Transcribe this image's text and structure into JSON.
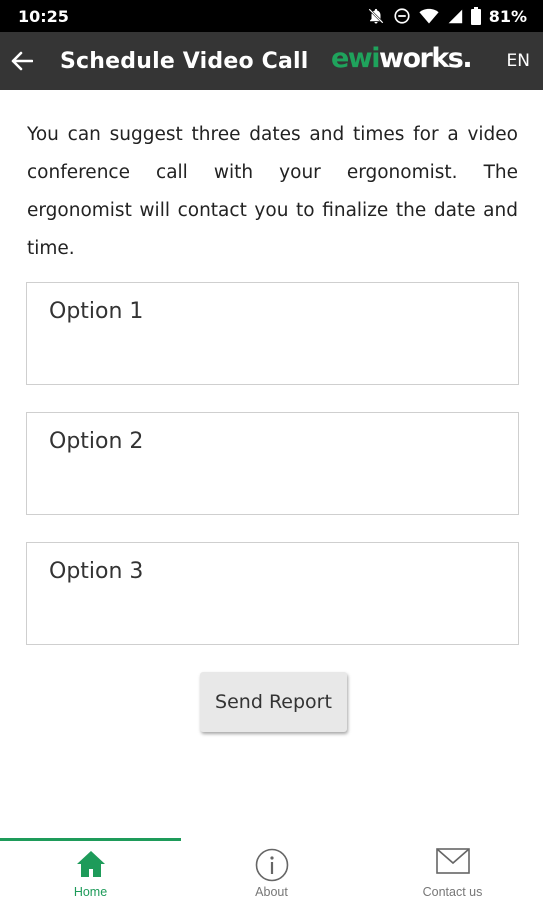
{
  "status_bar": {
    "time": "10:25",
    "battery": "81%"
  },
  "app_bar": {
    "title": "Schedule Video Call",
    "brand_ewi": "ewi",
    "brand_works": "works.",
    "language": "EN"
  },
  "intro_text": "You can suggest three dates and times for a video conference call with your ergonomist. The ergonomist will contact you to finalize the date and time.",
  "options": [
    {
      "placeholder": "Option 1"
    },
    {
      "placeholder": "Option 2"
    },
    {
      "placeholder": "Option 3"
    }
  ],
  "send_label": "Send Report",
  "bottom_nav": [
    {
      "label": "Home",
      "icon": "home-icon",
      "active": true
    },
    {
      "label": "About",
      "icon": "info-icon",
      "active": false
    },
    {
      "label": "Contact us",
      "icon": "mail-icon",
      "active": false
    }
  ],
  "colors": {
    "accent": "#1e9b5a",
    "app_bar": "#353535",
    "status_bar": "#000000"
  }
}
